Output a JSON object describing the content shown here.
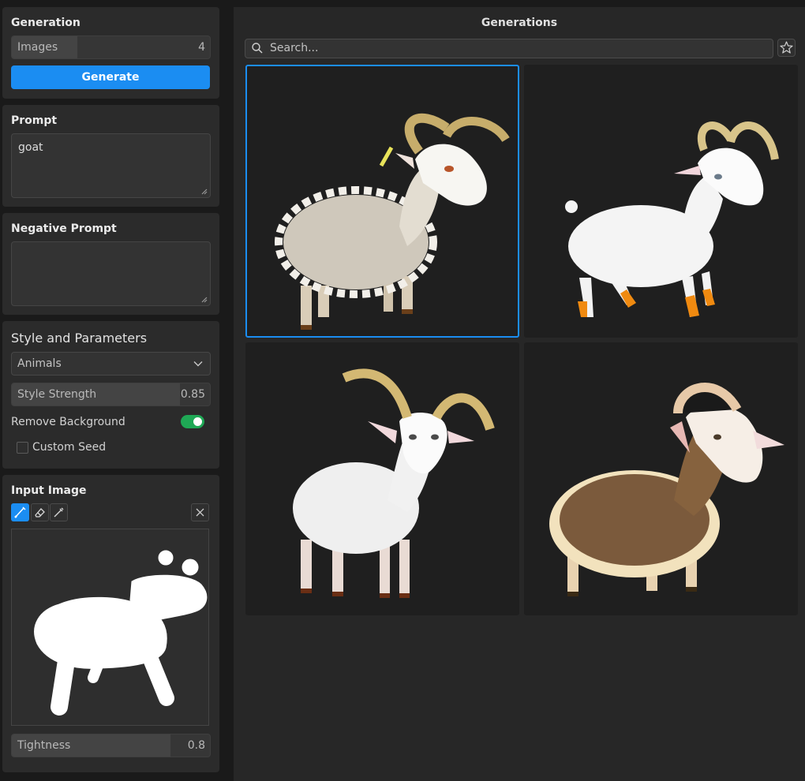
{
  "generation": {
    "title": "Generation",
    "images_label": "Images",
    "images_value": "4",
    "images_fill": 0.33,
    "generate_label": "Generate"
  },
  "prompt": {
    "title": "Prompt",
    "value": "goat"
  },
  "negative_prompt": {
    "title": "Negative Prompt",
    "value": ""
  },
  "style": {
    "title": "Style and Parameters",
    "selected": "Animals",
    "strength_label": "Style Strength",
    "strength_value": "0.85",
    "strength_fill": 0.85,
    "remove_bg_label": "Remove Background",
    "remove_bg_on": true,
    "custom_seed_label": "Custom Seed",
    "custom_seed_checked": false
  },
  "input_image": {
    "title": "Input Image",
    "tools": [
      "brush-icon",
      "eraser-icon",
      "eyedropper-icon"
    ],
    "tightness_label": "Tightness",
    "tightness_value": "0.8",
    "tightness_fill": 0.8
  },
  "generations": {
    "title": "Generations",
    "search_placeholder": "Search...",
    "items": [
      {
        "selected": true,
        "description": "goat with curly fleece"
      },
      {
        "selected": false,
        "description": "white goat"
      },
      {
        "selected": false,
        "description": "white goat with long horns"
      },
      {
        "selected": false,
        "description": "brown woolly goat"
      }
    ]
  },
  "colors": {
    "accent": "#1b8df2",
    "toggle_on": "#1fa855"
  }
}
